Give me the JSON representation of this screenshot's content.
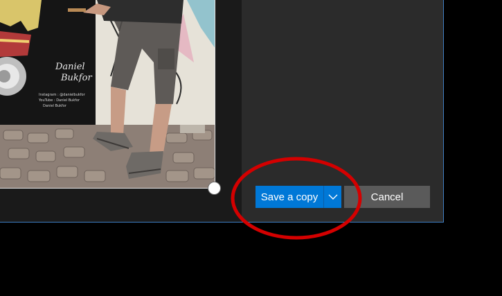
{
  "toolbar": {
    "save_label": "Save a copy",
    "cancel_label": "Cancel",
    "dropdown_icon": "chevron-down-icon"
  },
  "photo": {
    "handwritten_lines": [
      "Daniel",
      "Bukfor"
    ],
    "signature_caption": [
      "Instagram : @danielbukfor",
      "YouTube : Daniel Bukfor",
      "Daniel Bukfor"
    ]
  },
  "colors": {
    "accent": "#0078d7",
    "cancel_bg": "#5a5a5a",
    "panel_bg": "#2b2b2b",
    "annotation": "#d40000",
    "window_border": "#3f7fc4"
  }
}
